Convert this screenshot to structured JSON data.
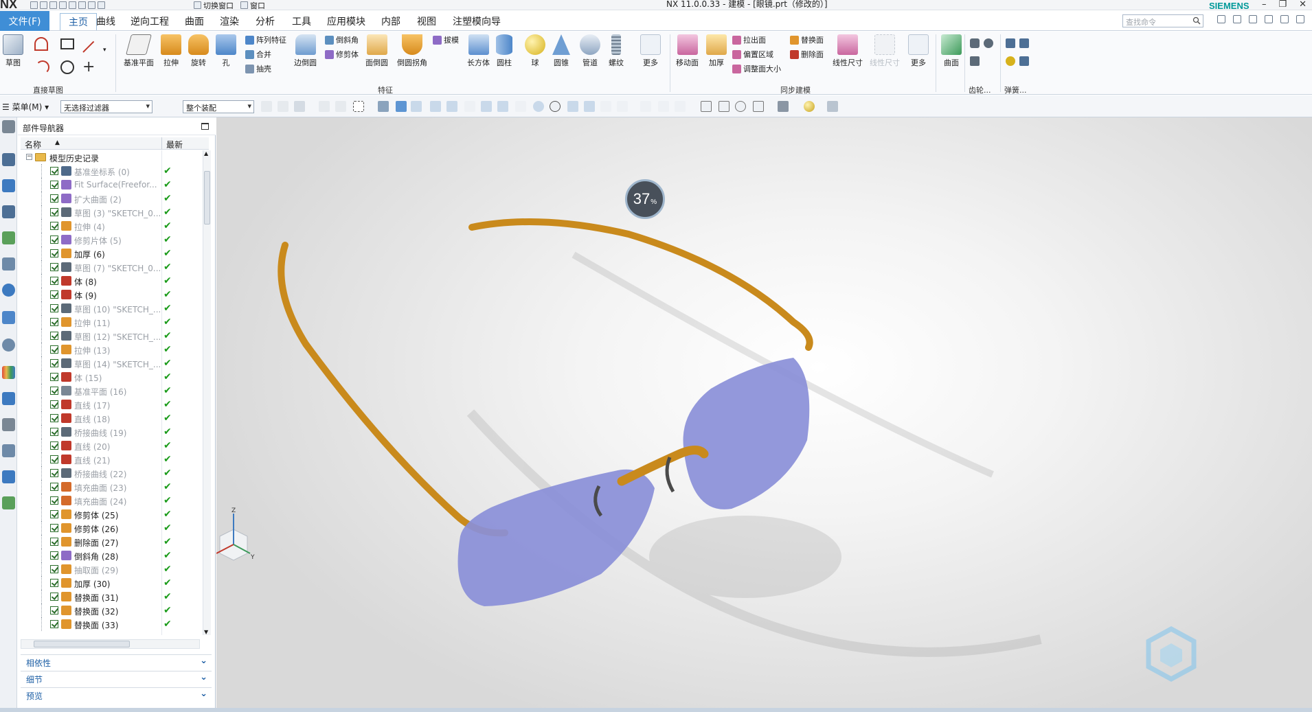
{
  "window": {
    "title": "NX 11.0.0.33 - 建模 - [眼镜.prt（修改的）]",
    "brand": "SIEMENS",
    "logo": "NX",
    "quick_access": [
      "切换窗口",
      "窗口"
    ]
  },
  "menubar": {
    "file": "文件(F)",
    "tabs": [
      "主页",
      "曲线",
      "逆向工程",
      "曲面",
      "渲染",
      "分析",
      "工具",
      "应用模块",
      "内部",
      "视图",
      "注塑模向导"
    ],
    "active_tab": "主页",
    "search_placeholder": "查找命令"
  },
  "ribbon": {
    "sketch": "草图",
    "direct_sketch": "直接草图",
    "features_group": "特征",
    "sync_group": "同步建模",
    "gear_group": "齿轮...",
    "spring_group": "弹簧...",
    "datum_plane": "基准平面",
    "extrude": "拉伸",
    "revolve": "旋转",
    "hole": "孔",
    "pattern_feature": "阵列特征",
    "unite": "合并",
    "shell": "抽壳",
    "edge_blend": "边倒圆",
    "chamfer": "倒斜角",
    "trim_body": "修剪体",
    "face_blend": "面倒圆",
    "blend_corner": "倒圆拐角",
    "draft": "拔模",
    "block": "长方体",
    "cylinder": "圆柱",
    "sphere": "球",
    "cone": "圆锥",
    "tube": "管道",
    "thread": "螺纹",
    "more": "更多",
    "move_face": "移动面",
    "thicken": "加厚",
    "pull_face": "拉出面",
    "offset_region": "偏置区域",
    "resize": "调整面大小",
    "replace_face": "替换面",
    "delete_face": "删除面",
    "linear_dim": "线性尺寸",
    "linear_dim2": "线性尺寸",
    "more2": "更多",
    "surface": "曲面"
  },
  "toolbar2": {
    "menu": "菜单(M)",
    "filter": "无选择过滤器",
    "scope": "整个装配"
  },
  "navigator": {
    "title": "部件导航器",
    "col_name": "名称",
    "col_latest": "最新",
    "root": "模型历史记录",
    "items": [
      {
        "label": "基准坐标系 (0)",
        "dim": true,
        "icon_color": "#4f6a8a"
      },
      {
        "label": "Fit Surface(Freefor...",
        "dim": true,
        "icon_color": "#8e6bc6"
      },
      {
        "label": "扩大曲面 (2)",
        "dim": true,
        "icon_color": "#8e6bc6"
      },
      {
        "label": "草图 (3) \"SKETCH_0...",
        "dim": true,
        "icon_color": "#5c6a78"
      },
      {
        "label": "拉伸 (4)",
        "dim": true,
        "icon_color": "#e0952d"
      },
      {
        "label": "修剪片体 (5)",
        "dim": true,
        "icon_color": "#8e6bc6"
      },
      {
        "label": "加厚 (6)",
        "dim": false,
        "icon_color": "#e0952d"
      },
      {
        "label": "草图 (7) \"SKETCH_0...",
        "dim": true,
        "icon_color": "#5c6a78"
      },
      {
        "label": "体 (8)",
        "dim": false,
        "icon_color": "#c0392b"
      },
      {
        "label": "体 (9)",
        "dim": false,
        "icon_color": "#c0392b"
      },
      {
        "label": "草图 (10) \"SKETCH_...",
        "dim": true,
        "icon_color": "#5c6a78"
      },
      {
        "label": "拉伸 (11)",
        "dim": true,
        "icon_color": "#e0952d"
      },
      {
        "label": "草图 (12) \"SKETCH_...",
        "dim": true,
        "icon_color": "#5c6a78"
      },
      {
        "label": "拉伸 (13)",
        "dim": true,
        "icon_color": "#e0952d"
      },
      {
        "label": "草图 (14) \"SKETCH_...",
        "dim": true,
        "icon_color": "#5c6a78"
      },
      {
        "label": "体 (15)",
        "dim": true,
        "icon_color": "#c0392b"
      },
      {
        "label": "基准平面 (16)",
        "dim": true,
        "icon_color": "#7a8794"
      },
      {
        "label": "直线 (17)",
        "dim": true,
        "icon_color": "#c0392b"
      },
      {
        "label": "直线 (18)",
        "dim": true,
        "icon_color": "#c0392b"
      },
      {
        "label": "桥接曲线 (19)",
        "dim": true,
        "icon_color": "#5c6a78"
      },
      {
        "label": "直线 (20)",
        "dim": true,
        "icon_color": "#c0392b"
      },
      {
        "label": "直线 (21)",
        "dim": true,
        "icon_color": "#c0392b"
      },
      {
        "label": "桥接曲线 (22)",
        "dim": true,
        "icon_color": "#5c6a78"
      },
      {
        "label": "填充曲面 (23)",
        "dim": true,
        "icon_color": "#d46a2a"
      },
      {
        "label": "填充曲面 (24)",
        "dim": true,
        "icon_color": "#d46a2a"
      },
      {
        "label": "修剪体 (25)",
        "dim": false,
        "icon_color": "#e0952d"
      },
      {
        "label": "修剪体 (26)",
        "dim": false,
        "icon_color": "#e0952d"
      },
      {
        "label": "删除面 (27)",
        "dim": false,
        "icon_color": "#e0952d"
      },
      {
        "label": "倒斜角 (28)",
        "dim": false,
        "icon_color": "#8e6bc6"
      },
      {
        "label": "抽取面 (29)",
        "dim": true,
        "icon_color": "#e0952d"
      },
      {
        "label": "加厚 (30)",
        "dim": false,
        "icon_color": "#e0952d"
      },
      {
        "label": "替换面 (31)",
        "dim": false,
        "icon_color": "#e0952d"
      },
      {
        "label": "替换面 (32)",
        "dim": false,
        "icon_color": "#e0952d"
      },
      {
        "label": "替换面 (33)",
        "dim": false,
        "icon_color": "#e0952d"
      }
    ]
  },
  "panels": [
    "相依性",
    "细节",
    "预览"
  ],
  "viewport": {
    "progress_text": "37",
    "progress_unit": "%",
    "progress_value": 0.37,
    "colors": {
      "frame": "#c98a1c",
      "lens": "#8a8fd8",
      "accent": "#3f8ed6"
    }
  }
}
